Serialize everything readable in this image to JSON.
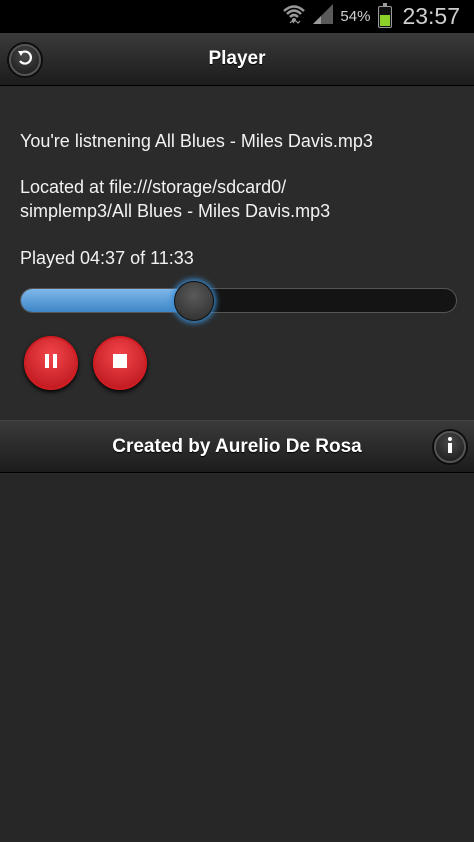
{
  "status_bar": {
    "battery_percent": "54%",
    "battery_level": 0.54,
    "clock": "23:57",
    "icons": [
      "wifi-icon",
      "signal-icon",
      "battery-icon"
    ]
  },
  "header": {
    "title": "Player",
    "back_icon": "back-icon"
  },
  "player": {
    "now_playing": "You're listnening All Blues - Miles Davis.mp3",
    "location_line1": "Located at file:///storage/sdcard0/",
    "location_line2": "simplemp3/All Blues - Miles Davis.mp3",
    "played_text": "Played 04:37 of 11:33",
    "progress": 0.399,
    "controls": [
      "pause-icon",
      "stop-icon"
    ]
  },
  "footer": {
    "text": "Created by Aurelio De Rosa",
    "info_icon": "info-icon"
  },
  "colors": {
    "accent_blue": "#3e86c8",
    "button_red": "#d11c22",
    "battery_green": "#8bd12a"
  }
}
